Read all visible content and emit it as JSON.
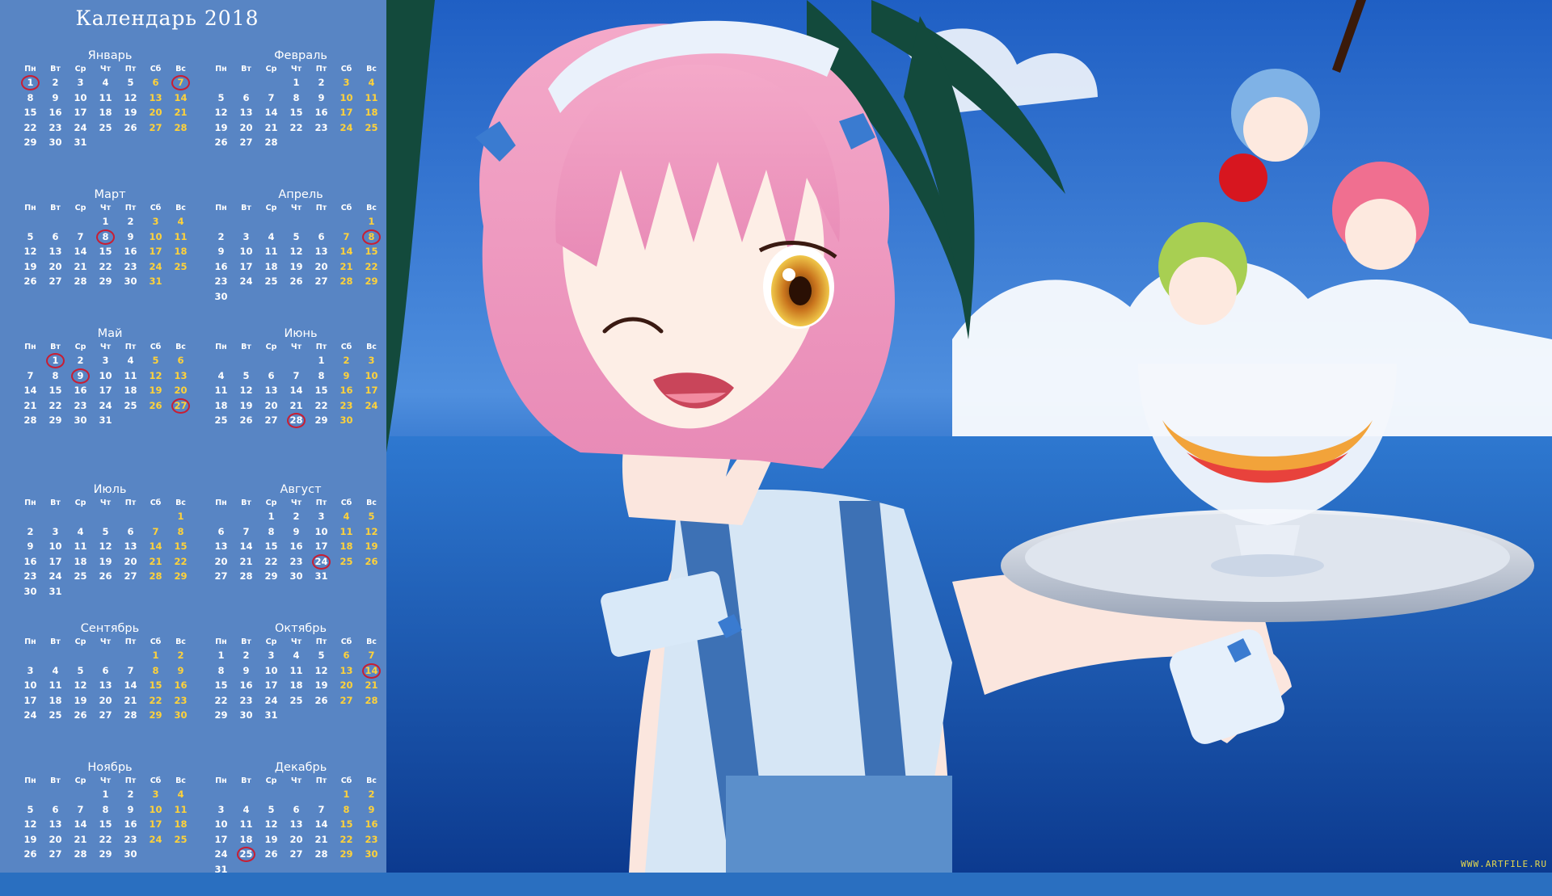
{
  "calendar": {
    "title": "Календарь 2018",
    "weekdays": [
      "Пн",
      "Вт",
      "Ср",
      "Чт",
      "Пт",
      "Сб",
      "Вс"
    ],
    "months": [
      {
        "name": "Январь",
        "start": 0,
        "days": 31,
        "circled": [
          1,
          7
        ]
      },
      {
        "name": "Февраль",
        "start": 3,
        "days": 28,
        "circled": []
      },
      {
        "name": "Март",
        "start": 3,
        "days": 31,
        "circled": [
          8
        ]
      },
      {
        "name": "Апрель",
        "start": 6,
        "days": 30,
        "circled": [
          8
        ]
      },
      {
        "name": "Май",
        "start": 1,
        "days": 31,
        "circled": [
          1,
          9,
          27
        ]
      },
      {
        "name": "Июнь",
        "start": 4,
        "days": 30,
        "circled": [
          28
        ]
      },
      {
        "name": "Июль",
        "start": 6,
        "days": 31,
        "circled": []
      },
      {
        "name": "Август",
        "start": 2,
        "days": 31,
        "circled": [
          24
        ]
      },
      {
        "name": "Сентябрь",
        "start": 5,
        "days": 30,
        "circled": []
      },
      {
        "name": "Октябрь",
        "start": 0,
        "days": 31,
        "circled": [
          14
        ]
      },
      {
        "name": "Ноябрь",
        "start": 3,
        "days": 30,
        "circled": []
      },
      {
        "name": "Декабрь",
        "start": 5,
        "days": 31,
        "circled": [
          25
        ]
      }
    ]
  },
  "colors": {
    "panel": "#5885c4",
    "weekday_text": "#ffffff",
    "weekend_text": "#ffd23a",
    "holiday_circle": "#c81e33"
  },
  "watermark": "WWW.ARTFILE.RU"
}
